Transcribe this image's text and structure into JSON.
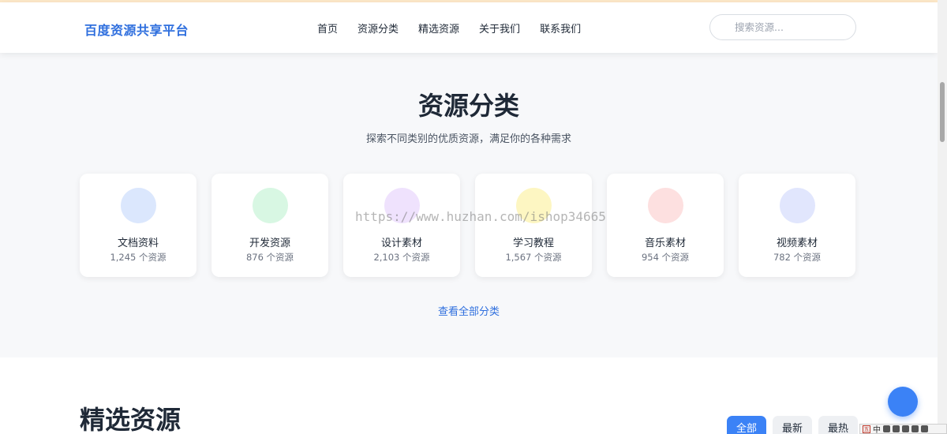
{
  "navbar": {
    "brand": "百度资源共享平台",
    "links": [
      "首页",
      "资源分类",
      "精选资源",
      "关于我们",
      "联系我们"
    ],
    "search_placeholder": "搜索资源..."
  },
  "categories": {
    "title": "资源分类",
    "subtitle": "探索不同类别的优质资源，满足你的各种需求",
    "items": [
      {
        "name": "文档资料",
        "count": "1,245 个资源",
        "color": "#dbe7fd"
      },
      {
        "name": "开发资源",
        "count": "876 个资源",
        "color": "#d8f7e3"
      },
      {
        "name": "设计素材",
        "count": "2,103 个资源",
        "color": "#efe2fd"
      },
      {
        "name": "学习教程",
        "count": "1,567 个资源",
        "color": "#fdf6c2"
      },
      {
        "name": "音乐素材",
        "count": "954 个资源",
        "color": "#fde0e0"
      },
      {
        "name": "视频素材",
        "count": "782 个资源",
        "color": "#e1e6fd"
      }
    ],
    "view_all": "查看全部分类"
  },
  "featured": {
    "title": "精选资源",
    "filters": [
      "全部",
      "最新",
      "最热"
    ],
    "active_filter": "全部"
  },
  "watermark": "https://www.huzhan.com/ishop34665",
  "ime": {
    "logo": "五",
    "mode": "中"
  },
  "colors": {
    "accent": "#3b82f6",
    "brand": "#2f6fde"
  }
}
